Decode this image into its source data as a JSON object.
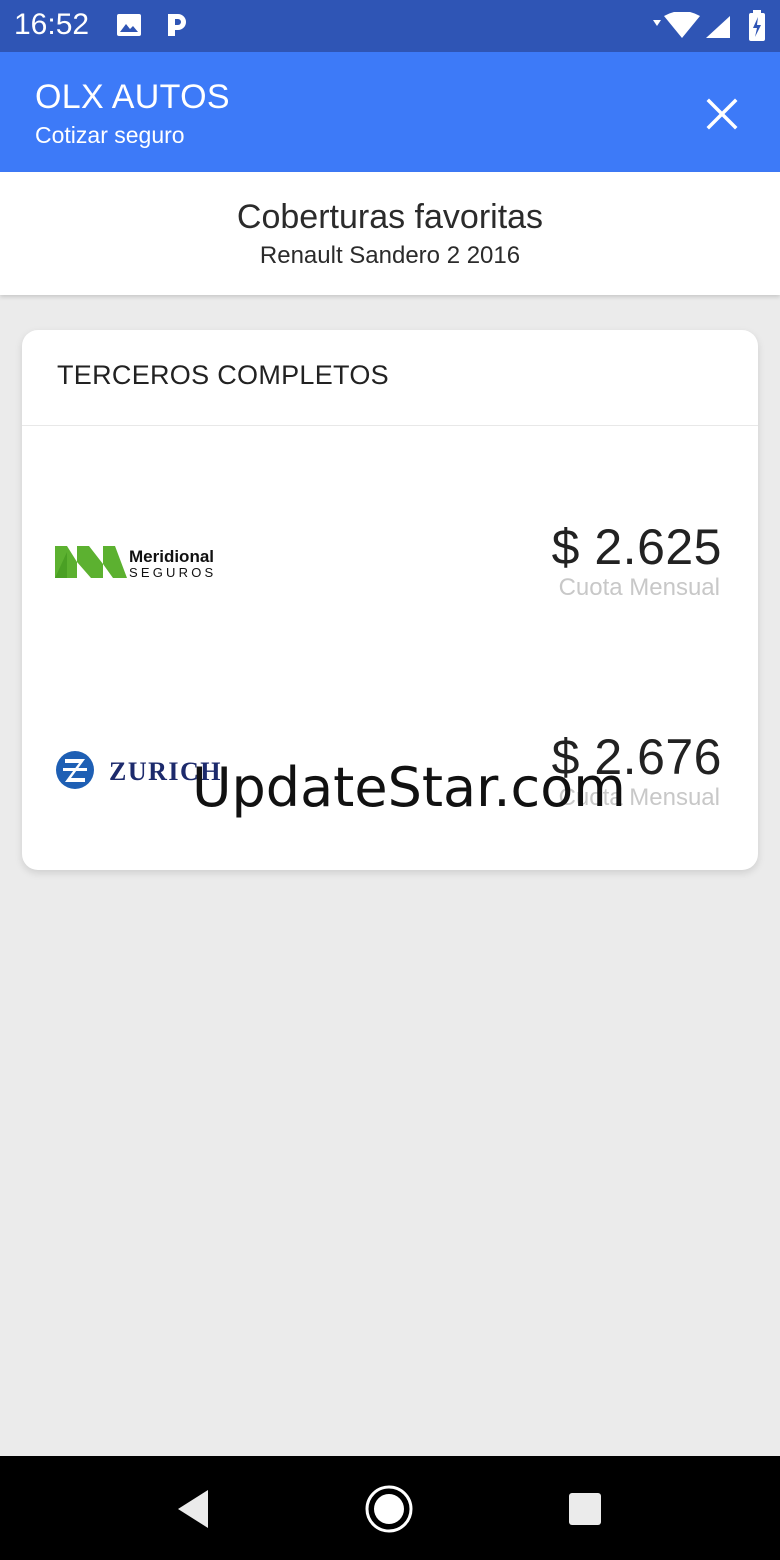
{
  "status_bar": {
    "time": "16:52",
    "icons": [
      "image-icon",
      "parking-p-icon",
      "wifi-icon",
      "signal-icon",
      "battery-charging-icon"
    ]
  },
  "app_bar": {
    "title": "OLX AUTOS",
    "subtitle": "Cotizar seguro",
    "close_icon": "close-icon",
    "background": "#3d7af8"
  },
  "header": {
    "title": "Coberturas favoritas",
    "vehicle": "Renault Sandero 2 2016"
  },
  "card": {
    "heading": "TERCEROS COMPLETOS",
    "quotes": [
      {
        "insurer_logo_text": [
          "Meridional",
          "SEGUROS"
        ],
        "price": "$ 2.625",
        "price_label": "Cuota Mensual"
      },
      {
        "insurer_logo_text": [
          "ZURICH"
        ],
        "price": "$ 2.676",
        "price_label": "Cuota Mensual"
      }
    ]
  },
  "watermark": "UpdateStar.com",
  "nav_bar": {
    "icons": [
      "back-icon",
      "home-icon",
      "recents-icon"
    ]
  }
}
